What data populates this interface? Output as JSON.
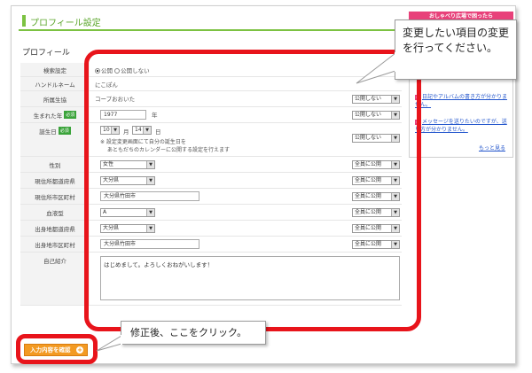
{
  "header": {
    "title": "プロフィール設定",
    "section": "プロフィール"
  },
  "side": {
    "banner": "おしゃべり広場で困ったら",
    "links": [
      "日記やアルバムの書き方が分かりません。",
      "メッセージを送りたいのですが、送り方が分かりません。"
    ],
    "more": "もっと見る"
  },
  "fields": {
    "search": {
      "label": "検索設定",
      "on": "公開",
      "off": "公開しない"
    },
    "handle": {
      "label": "ハンドルネーム",
      "value": "にこぽん"
    },
    "coop": {
      "label": "所属生協",
      "value": "コープおおいた",
      "privacy": "公開しない"
    },
    "birthyear": {
      "label": "生まれた年",
      "required": "必須",
      "value": "1977",
      "unit": "年",
      "privacy": "公開しない"
    },
    "birthday": {
      "label": "誕生日",
      "required": "必須",
      "month": "10",
      "month_unit": "月",
      "day": "14",
      "day_unit": "日",
      "note1": "※ 設定変更画面にて自分の誕生日を",
      "note2": "あともだちのカレンダーに公開する設定を行えます",
      "privacy": "公開しない"
    },
    "gender": {
      "label": "性別",
      "value": "女性",
      "privacy": "全員に公開"
    },
    "pref": {
      "label": "現住所都道府県",
      "value": "大分県",
      "privacy": "全員に公開"
    },
    "city": {
      "label": "現住所市区町村",
      "value": "大分県竹田市",
      "privacy": "全員に公開"
    },
    "blood": {
      "label": "血液型",
      "value": "A",
      "privacy": "全員に公開"
    },
    "bpref": {
      "label": "出身地都道府県",
      "value": "大分県",
      "privacy": "全員に公開"
    },
    "bcity": {
      "label": "出身地市区町村",
      "value": "大分県竹田市",
      "privacy": "全員に公開"
    },
    "intro": {
      "label": "自己紹介",
      "value": "はじめまして。よろしくおねがいします！"
    }
  },
  "confirm_label": "入力内容を確認",
  "callouts": {
    "top": "変更したい項目の変更を行ってください。",
    "bottom": "修正後、ここをクリック。"
  },
  "colors": {
    "accent_green": "#7cc242",
    "highlight_red": "#e8141b",
    "button_orange": "#f39a22",
    "side_pink": "#e8417a"
  }
}
